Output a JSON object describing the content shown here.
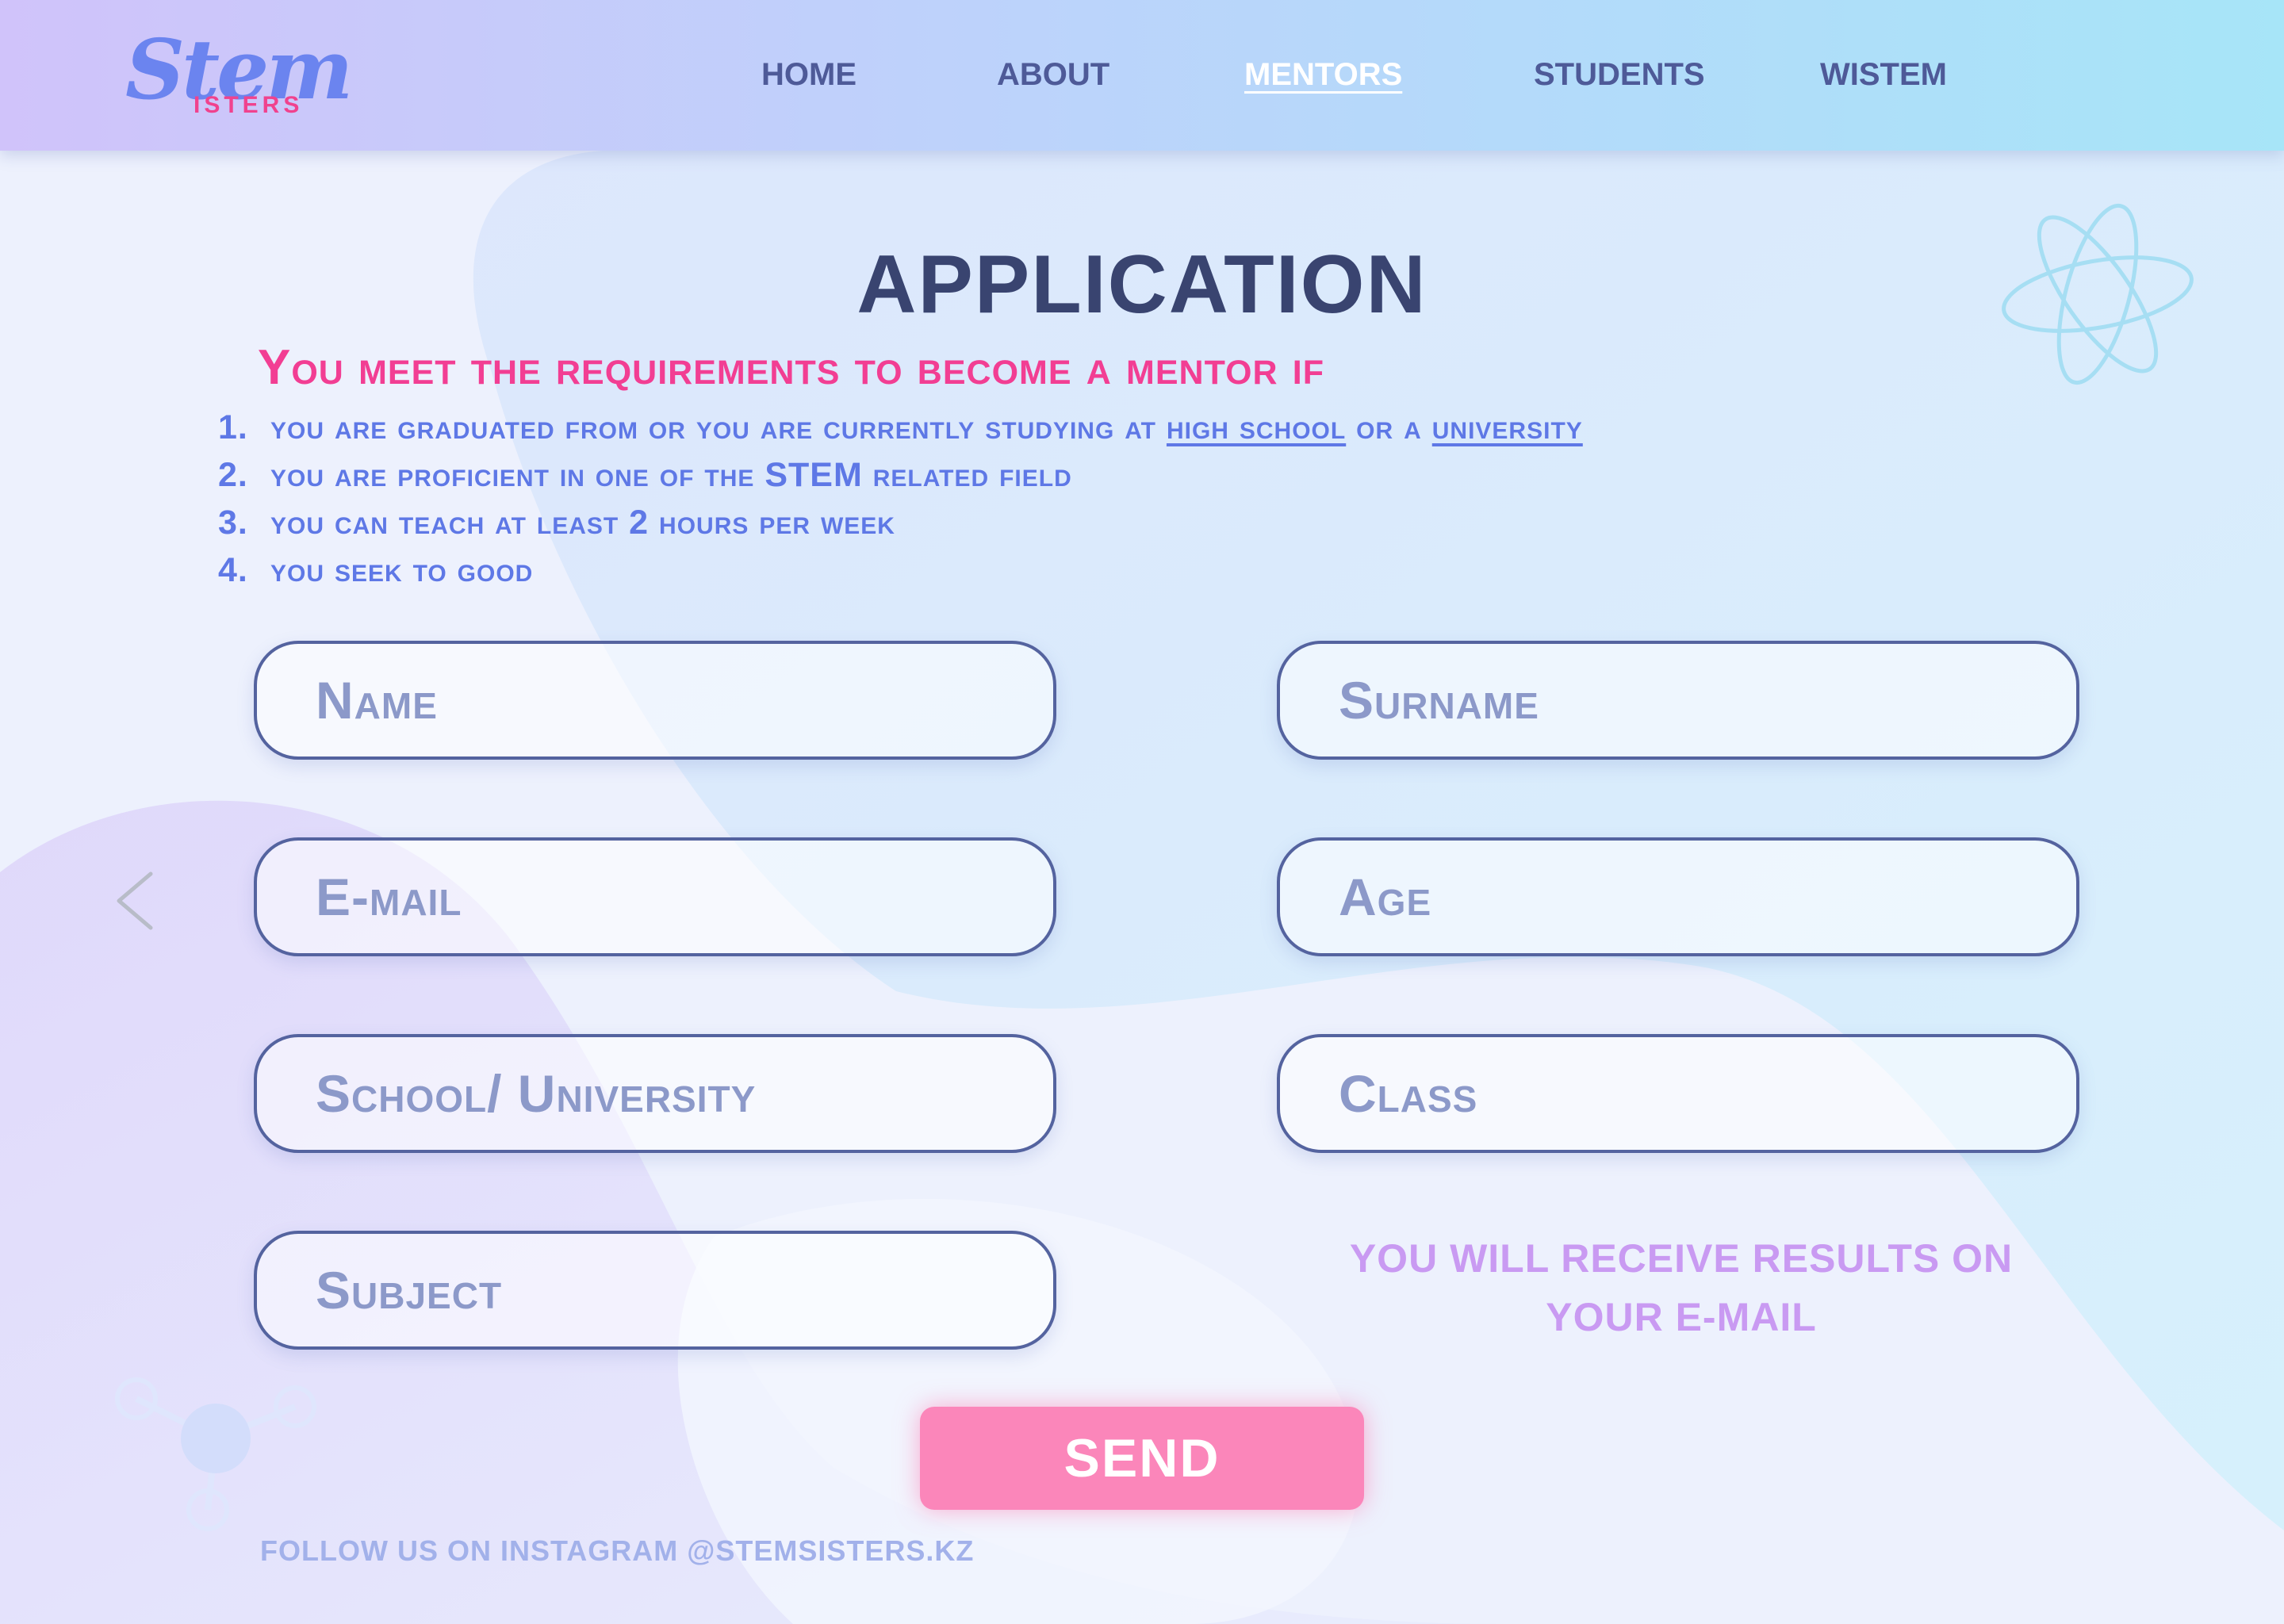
{
  "logo": {
    "word": "Stem",
    "sub": "ISTERS"
  },
  "nav": [
    {
      "label": "HOME",
      "active": false
    },
    {
      "label": "ABOUT",
      "active": false
    },
    {
      "label": "MENTORS",
      "active": true
    },
    {
      "label": "STUDENTS",
      "active": false
    },
    {
      "label": "WISTEM",
      "active": false
    }
  ],
  "page": {
    "title": "APPLICATION",
    "requirements_heading": "You meet the requirements to become a mentor if",
    "requirements": [
      {
        "num": "1.",
        "text": "you are graduated from or you are currently studying at ",
        "link1": "high school",
        "mid": " or a ",
        "link2": "university"
      },
      {
        "num": "2.",
        "text": "you are proficient in one of the STEM related field"
      },
      {
        "num": "3.",
        "text": "you can teach at least 2 hours per week"
      },
      {
        "num": "4.",
        "text": "you seek to good"
      }
    ]
  },
  "form": {
    "name_placeholder": "Name",
    "surname_placeholder": "Surname",
    "email_placeholder": "E-mail",
    "age_placeholder": "Age",
    "school_placeholder": "School/ University",
    "class_placeholder": "Class",
    "subject_placeholder": "Subject",
    "note_line1": "YOU WILL RECEIVE RESULTS ON",
    "note_line2": "YOUR E-MAIL",
    "send_label": "SEND"
  },
  "footer": {
    "text": "FOLLOW US ON INSTAGRAM @STEMSISTERS.KZ"
  },
  "colors": {
    "accent_pink": "#f23e93",
    "send_button": "#fb86ba",
    "nav_text": "#4e5a98",
    "title_text": "#394470",
    "requirements_text": "#5e78e6",
    "note_text": "#c99af2"
  },
  "icons": {
    "back": "chevron-left-icon",
    "atom": "atom-icon",
    "molecule": "molecule-icon"
  }
}
